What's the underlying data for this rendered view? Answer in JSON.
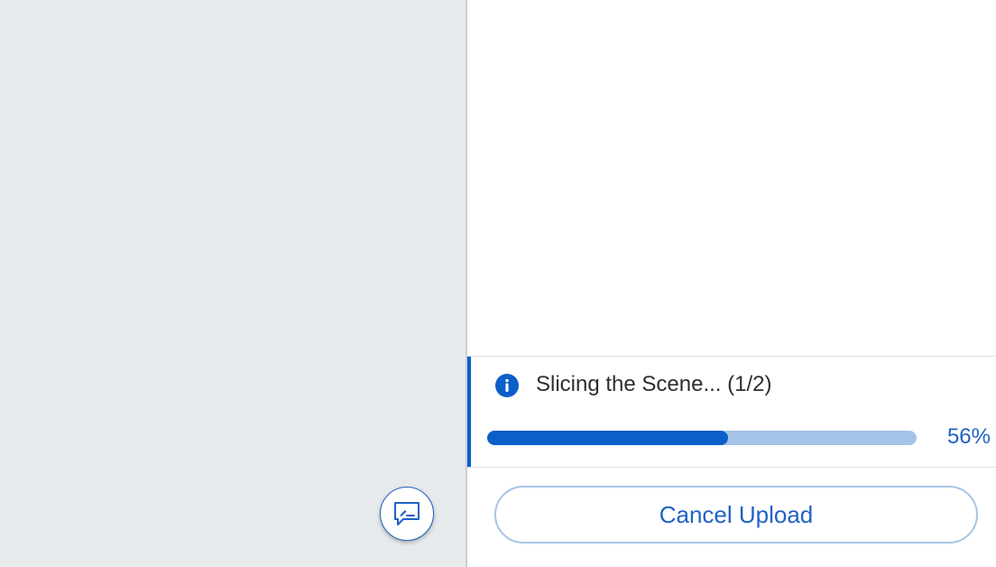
{
  "left_pane": {
    "feedback_button": {
      "icon": "feedback-icon"
    }
  },
  "upload_status": {
    "icon": "info-icon",
    "message": "Slicing the Scene... (1/2)",
    "progress_percent_label": "56%",
    "progress_fraction": 0.56,
    "cancel_label": "Cancel Upload"
  },
  "colors": {
    "accent": "#0a5fc9",
    "track": "#a3c3e8",
    "link_text": "#1f62c4",
    "left_background": "#e6eaed"
  }
}
